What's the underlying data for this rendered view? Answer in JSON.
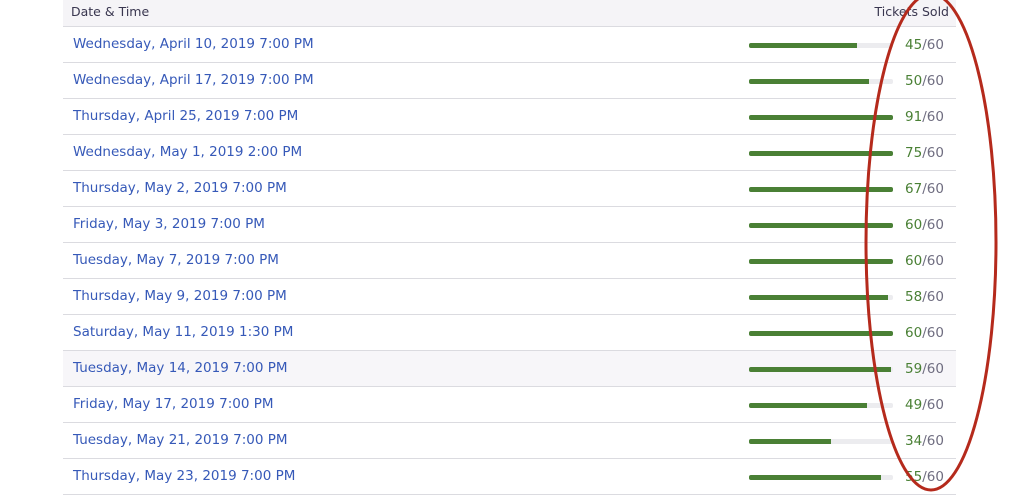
{
  "header": {
    "date_label": "Date & Time",
    "sold_label": "Tickets Sold"
  },
  "colors": {
    "link": "#3659b8",
    "bar": "#4a8035",
    "annotation": "#b52a1c"
  },
  "rows": [
    {
      "date": "Wednesday, April 10, 2019 7:00 PM",
      "sold": "45",
      "capacity": "60"
    },
    {
      "date": "Wednesday, April 17, 2019 7:00 PM",
      "sold": "50",
      "capacity": "60"
    },
    {
      "date": "Thursday, April 25, 2019 7:00 PM",
      "sold": "91",
      "capacity": "60"
    },
    {
      "date": "Wednesday, May 1, 2019 2:00 PM",
      "sold": "75",
      "capacity": "60"
    },
    {
      "date": "Thursday, May 2, 2019 7:00 PM",
      "sold": "67",
      "capacity": "60"
    },
    {
      "date": "Friday, May 3, 2019 7:00 PM",
      "sold": "60",
      "capacity": "60"
    },
    {
      "date": "Tuesday, May 7, 2019 7:00 PM",
      "sold": "60",
      "capacity": "60"
    },
    {
      "date": "Thursday, May 9, 2019 7:00 PM",
      "sold": "58",
      "capacity": "60"
    },
    {
      "date": "Saturday, May 11, 2019 1:30 PM",
      "sold": "60",
      "capacity": "60"
    },
    {
      "date": "Tuesday, May 14, 2019 7:00 PM",
      "sold": "59",
      "capacity": "60"
    },
    {
      "date": "Friday, May 17, 2019 7:00 PM",
      "sold": "49",
      "capacity": "60"
    },
    {
      "date": "Tuesday, May 21, 2019 7:00 PM",
      "sold": "34",
      "capacity": "60"
    },
    {
      "date": "Thursday, May 23, 2019 7:00 PM",
      "sold": "55",
      "capacity": "60"
    }
  ]
}
